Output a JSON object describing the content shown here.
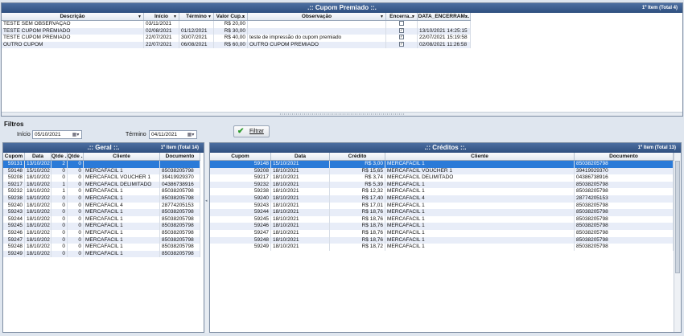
{
  "cupom": {
    "title": ".:: Cupom Premiado ::.",
    "count": "1º Item (Total 4)",
    "columns": [
      "Descrição",
      "Início",
      "Término",
      "Valor Cup...",
      "Observação",
      "Encerra...",
      "DATA_ENCERRAM..."
    ],
    "rows": [
      {
        "descricao": "TESTE SEM OBSERVAÇÃO",
        "inicio": "03/11/2021",
        "termino": "",
        "valor": "R$ 20,00",
        "obs": "",
        "encerrado": false,
        "data_enc": ""
      },
      {
        "descricao": "TESTE CUPOM PREMIADO",
        "inicio": "02/08/2021",
        "termino": "01/12/2021",
        "valor": "R$ 30,00",
        "obs": "",
        "encerrado": true,
        "data_enc": "13/10/2021 14:25:15"
      },
      {
        "descricao": "TESTE CUPOM PREMIADO",
        "inicio": "22/07/2021",
        "termino": "30/07/2021",
        "valor": "R$ 40,00",
        "obs": "teste de impressão do cupom premiado",
        "encerrado": true,
        "data_enc": "22/07/2021 15:19:58"
      },
      {
        "descricao": "OUTRO CUPOM",
        "inicio": "22/07/2021",
        "termino": "06/08/2021",
        "valor": "R$ 60,00",
        "obs": "OUTRO CUPOM PREMIADO",
        "encerrado": true,
        "data_enc": "02/08/2021 11:26:58"
      }
    ]
  },
  "filtros": {
    "label": "Filtros",
    "inicio_label": "Início",
    "inicio_value": "05/10/2021",
    "termino_label": "Término",
    "termino_value": "04/11/2021",
    "filtrar_label": "Filtrar"
  },
  "geral": {
    "title": ".:: Geral ::.",
    "count": "1º Item (Total 14)",
    "columns": [
      "Cupom",
      "Data",
      "Qtde ...",
      "Qtde ...",
      "Cliente",
      "Documento"
    ],
    "rows": [
      [
        "59131",
        "13/10/202",
        "2",
        "0",
        "",
        ""
      ],
      [
        "59148",
        "15/10/202",
        "0",
        "0",
        "MERCAFACIL 1",
        "85038205798"
      ],
      [
        "59208",
        "18/10/202",
        "0",
        "0",
        "MERCAFACIL VOUCHER 1",
        "39419929370"
      ],
      [
        "59217",
        "18/10/202",
        "1",
        "0",
        "MERCAFACIL DELIMITADO",
        "04386738916"
      ],
      [
        "59232",
        "18/10/202",
        "1",
        "0",
        "MERCAFACIL 1",
        "85038205798"
      ],
      [
        "59238",
        "18/10/202",
        "0",
        "0",
        "MERCAFACIL 1",
        "85038205798"
      ],
      [
        "59240",
        "18/10/202",
        "0",
        "0",
        "MERCAFACIL 4",
        "28774205153"
      ],
      [
        "59243",
        "18/10/202",
        "0",
        "0",
        "MERCAFACIL 1",
        "85038205798"
      ],
      [
        "59244",
        "18/10/202",
        "0",
        "0",
        "MERCAFACIL 1",
        "85038205798"
      ],
      [
        "59245",
        "18/10/202",
        "0",
        "0",
        "MERCAFACIL 1",
        "85038205798"
      ],
      [
        "59246",
        "18/10/202",
        "0",
        "0",
        "MERCAFACIL 1",
        "85038205798"
      ],
      [
        "59247",
        "18/10/202",
        "0",
        "0",
        "MERCAFACIL 1",
        "85038205798"
      ],
      [
        "59248",
        "18/10/202",
        "0",
        "0",
        "MERCAFACIL 1",
        "85038205798"
      ],
      [
        "59249",
        "18/10/202",
        "0",
        "0",
        "MERCAFACIL 1",
        "85038205798"
      ]
    ]
  },
  "creditos": {
    "title": ".:: Créditos ::.",
    "count": "1º Item (Total 13)",
    "columns": [
      "Cupom",
      "Data",
      "Crédito",
      "Cliente",
      "Documento"
    ],
    "rows": [
      [
        "59148",
        "15/10/2021",
        "R$ 3,00",
        "MERCAFACIL 1",
        "85038205798"
      ],
      [
        "59208",
        "18/10/2021",
        "R$ 15,65",
        "MERCAFACIL VOUCHER 1",
        "39419929370"
      ],
      [
        "59217",
        "18/10/2021",
        "R$ 3,74",
        "MERCAFACIL DELIMITADO",
        "04386738916"
      ],
      [
        "59232",
        "18/10/2021",
        "R$ 5,39",
        "MERCAFACIL 1",
        "85038205798"
      ],
      [
        "59238",
        "18/10/2021",
        "R$ 12,32",
        "MERCAFACIL 1",
        "85038205798"
      ],
      [
        "59240",
        "18/10/2021",
        "R$ 17,40",
        "MERCAFACIL 4",
        "28774205153"
      ],
      [
        "59243",
        "18/10/2021",
        "R$ 17,01",
        "MERCAFACIL 1",
        "85038205798"
      ],
      [
        "59244",
        "18/10/2021",
        "R$ 18,76",
        "MERCAFACIL 1",
        "85038205798"
      ],
      [
        "59245",
        "18/10/2021",
        "R$ 18,76",
        "MERCAFACIL 1",
        "85038205798"
      ],
      [
        "59246",
        "18/10/2021",
        "R$ 18,76",
        "MERCAFACIL 1",
        "85038205798"
      ],
      [
        "59247",
        "18/10/2021",
        "R$ 18,76",
        "MERCAFACIL 1",
        "85038205798"
      ],
      [
        "59248",
        "18/10/2021",
        "R$ 18,76",
        "MERCAFACIL 1",
        "85038205798"
      ],
      [
        "59249",
        "18/10/2021",
        "R$ 18,72",
        "MERCAFACIL 1",
        "85038205798"
      ]
    ]
  }
}
